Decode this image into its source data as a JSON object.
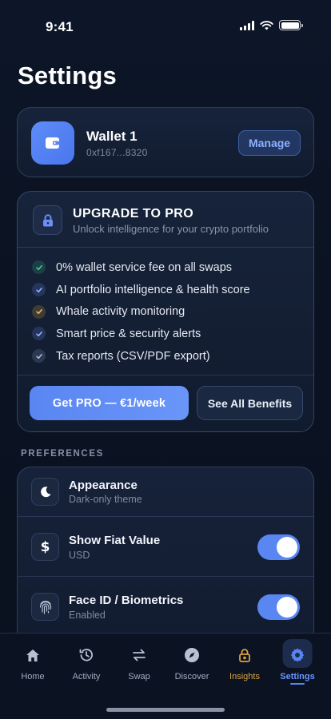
{
  "status": {
    "time": "9:41"
  },
  "page": {
    "title": "Settings"
  },
  "wallet": {
    "name": "Wallet 1",
    "address": "0xf167...8320",
    "manage_label": "Manage"
  },
  "pro": {
    "title": "UPGRADE TO PRO",
    "subtitle": "Unlock intelligence for your crypto portfolio",
    "benefits": [
      {
        "label": "0% wallet service fee on all swaps",
        "color": "#3ecf8e"
      },
      {
        "label": "AI portfolio intelligence & health score",
        "color": "#6b8ff5"
      },
      {
        "label": "Whale activity monitoring",
        "color": "#d9a441"
      },
      {
        "label": "Smart price & security alerts",
        "color": "#6b8ff5"
      },
      {
        "label": "Tax reports (CSV/PDF export)",
        "color": "#8aa0c8"
      }
    ],
    "cta_label": "Get PRO — €1/week",
    "see_all_label": "See All Benefits"
  },
  "preferences": {
    "section_label": "PREFERENCES",
    "rows": [
      {
        "title": "Appearance",
        "subtitle": "Dark-only theme",
        "icon": "moon-icon"
      },
      {
        "title": "Show Fiat Value",
        "subtitle": "USD",
        "icon": "dollar-icon",
        "toggle": true
      },
      {
        "title": "Face ID / Biometrics",
        "subtitle": "Enabled",
        "icon": "fingerprint-icon",
        "toggle": true
      }
    ]
  },
  "tabs": [
    {
      "label": "Home",
      "icon": "home-icon"
    },
    {
      "label": "Activity",
      "icon": "history-icon"
    },
    {
      "label": "Swap",
      "icon": "swap-icon"
    },
    {
      "label": "Discover",
      "icon": "compass-icon"
    },
    {
      "label": "Insights",
      "icon": "lock-icon"
    },
    {
      "label": "Settings",
      "icon": "gear-icon",
      "active": true
    }
  ],
  "colors": {
    "accent": "#5a86f2",
    "insights": "#d9a441",
    "background": "#0b1322"
  }
}
